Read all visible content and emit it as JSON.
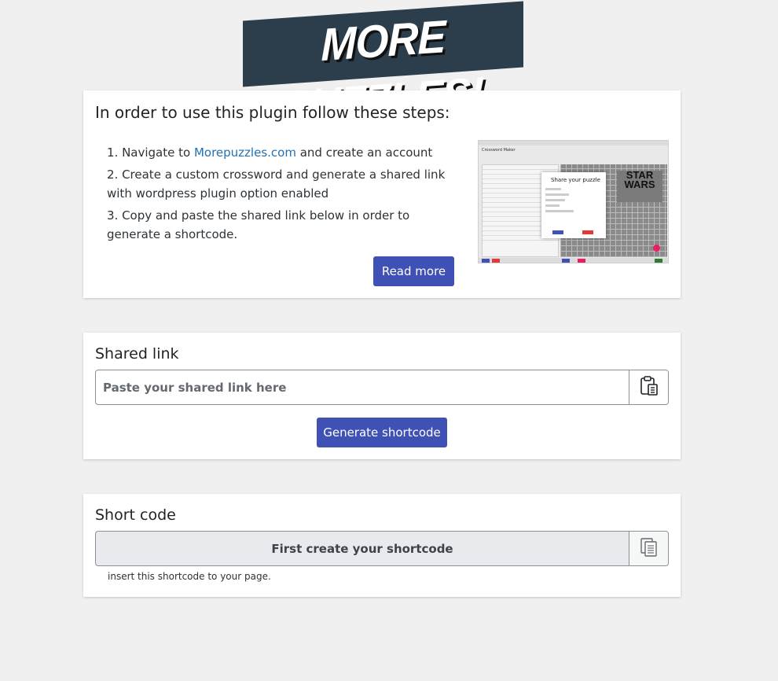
{
  "logo": {
    "text": "MORE PUZZLES!"
  },
  "instructions": {
    "title": "In order to use this plugin follow these steps:",
    "step1_prefix": "1. Navigate to ",
    "step1_link": "Morepuzzles.com",
    "step1_suffix": " and create an account",
    "step2": "2. Create a custom crossword and generate a shared link with wordpress plugin option enabled",
    "step3": "3. Copy and paste the shared link below in order to generate a shortcode.",
    "read_more_label": "Read more",
    "preview": {
      "app_title": "Crossword Maker",
      "modal_title": "Share your puzzle",
      "logo_text": "STAR WARS"
    }
  },
  "shared_link": {
    "title": "Shared link",
    "placeholder": "Paste your shared link here",
    "paste_icon": "clipboard-icon",
    "generate_label": "Generate shortcode"
  },
  "short_code": {
    "title": "Short code",
    "value": "First create your shortcode",
    "copy_icon": "copy-icon",
    "hint": "insert this shortcode to your page."
  },
  "colors": {
    "primary_button": "#3f51b5",
    "link": "#2271b1",
    "background": "#f0f0f1",
    "logo_bg": "#2c3e4c"
  }
}
